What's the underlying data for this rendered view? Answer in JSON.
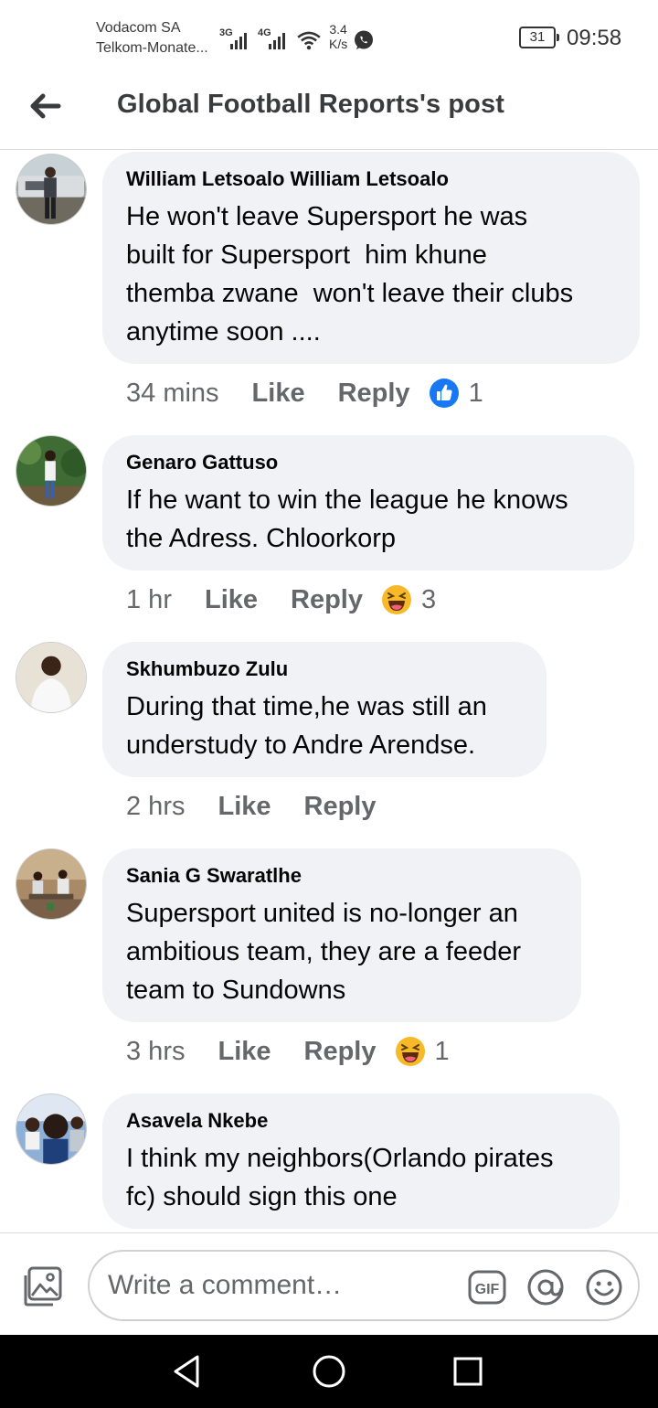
{
  "status_bar": {
    "carrier_line1": "Vodacom SA",
    "carrier_line2": "Telkom-Monate...",
    "net1": "3G",
    "net2": "4G",
    "speed_value": "3.4",
    "speed_unit": "K/s",
    "battery": "31",
    "time": "09:58"
  },
  "header": {
    "title": "Global Football Reports's post",
    "back_icon": "arrow-left-icon"
  },
  "comments": [
    {
      "author": "William Letsoalo William Letsoalo",
      "text": "He won't leave Supersport he was\nbuilt for Supersport  him khune\nthemba zwane  won't leave their clubs\nanytime soon ....",
      "time": "34 mins",
      "like_label": "Like",
      "reply_label": "Reply",
      "reaction_icon": "like-reaction-icon",
      "reaction_count": "1"
    },
    {
      "author": "Genaro Gattuso",
      "text": "If he want to win the league he knows\nthe Adress. Chloorkorp",
      "time": "1 hr",
      "like_label": "Like",
      "reply_label": "Reply",
      "reaction_icon": "haha-reaction-icon",
      "reaction_count": "3"
    },
    {
      "author": "Skhumbuzo Zulu",
      "text": "During that time,he was still an\nunderstudy to Andre Arendse.",
      "time": "2 hrs",
      "like_label": "Like",
      "reply_label": "Reply"
    },
    {
      "author": "Sania G Swaratlhe",
      "text": "Supersport united is no-longer an\nambitious team, they are a feeder\nteam to Sundowns",
      "time": "3 hrs",
      "like_label": "Like",
      "reply_label": "Reply",
      "reaction_icon": "haha-reaction-icon",
      "reaction_count": "1"
    },
    {
      "author": "Asavela Nkebe",
      "text": "I think my neighbors(Orlando pirates\nfc) should sign this one"
    }
  ],
  "composer": {
    "placeholder": "Write a comment…",
    "photo_icon": "photo-icon",
    "gif_icon": "gif-icon",
    "mention_icon": "at-mention-icon",
    "emoji_icon": "emoji-icon"
  },
  "navbar": {
    "back_icon": "nav-back-icon",
    "home_icon": "nav-home-icon",
    "recents_icon": "nav-recents-icon"
  },
  "colors": {
    "bubble": "#f0f2f5",
    "like_blue": "#1877f2",
    "haha_yellow": "#f7b928",
    "secondary_text": "#65676b"
  }
}
